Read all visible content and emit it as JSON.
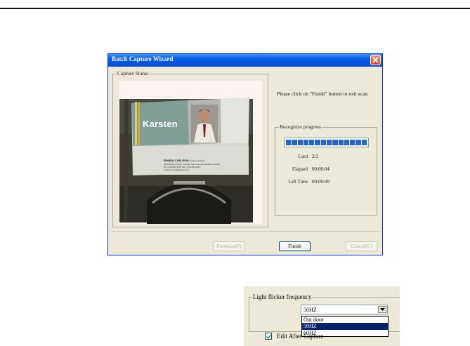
{
  "wizard": {
    "title": "Batch Capture Wizard",
    "capture_group_label": "Capture Status",
    "card_preview": {
      "brand": "Karsten",
      "name": "RONDA CARLSON",
      "name_suffix": "Creative Director",
      "lines": [
        "3022 Battery Street, sui 200, San Francisco California 94111",
        "Tel: (415)491-5678   Fax: (415)792-2019",
        "Contact: info@karsten.com"
      ]
    },
    "instruction": "Please click on \"Finish\" button to exit scan.",
    "progress_group_label": "Recognize progress",
    "progress_fraction": 1.0,
    "progress_segments": 14,
    "card_label": "Card",
    "card_value": "2/2",
    "elapsed_label": "Elapsed",
    "elapsed_value": "00:00:04",
    "left_time_label": "Left Time",
    "left_time_value": "00:00:00",
    "buttons": {
      "previous": "Previous(P)",
      "finish": "Finish",
      "cancel": "Cancel(C)"
    }
  },
  "flicker": {
    "group_label": "Light flicker frequency",
    "selected_value": "50HZ",
    "options": [
      "Out door",
      "50HZ",
      "60HZ"
    ],
    "selected_option": "50HZ",
    "edit_after_capture_label": "Edit After Capture",
    "edit_after_capture_checked": true
  },
  "colors": {
    "titlebar": "#0454d8",
    "progress_segment": "#2466c4",
    "dialog_face": "#ece9d8",
    "selection": "#0a246a"
  }
}
